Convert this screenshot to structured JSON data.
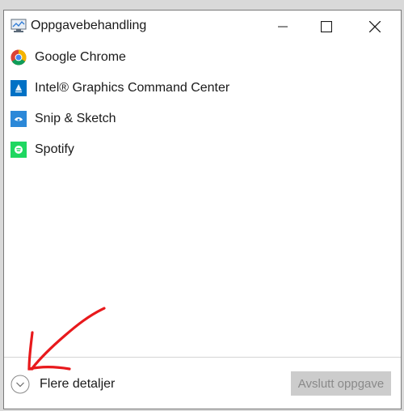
{
  "window": {
    "title": "Oppgavebehandling",
    "icon": "task-manager-icon"
  },
  "titlebar": {
    "minimize_icon": "minimize-icon",
    "maximize_icon": "maximize-icon",
    "close_icon": "close-icon"
  },
  "apps": [
    {
      "label": "Google Chrome",
      "icon": "chrome-icon",
      "color": "#4285f4"
    },
    {
      "label": "Intel® Graphics Command Center",
      "icon": "intel-graphics-icon",
      "color": "#0071c5"
    },
    {
      "label": "Snip & Sketch",
      "icon": "snip-sketch-icon",
      "color": "#2b88d8"
    },
    {
      "label": "Spotify",
      "icon": "spotify-icon",
      "color": "#1ed760"
    }
  ],
  "footer": {
    "details_label": "Flere detaljer",
    "details_icon": "chevron-down-circle-icon",
    "end_task_label": "Avslutt oppgave"
  },
  "colors": {
    "annotation_arrow": "#e8191c",
    "disabled_button_bg": "#cccccc",
    "disabled_button_text": "#8a8a8a"
  }
}
